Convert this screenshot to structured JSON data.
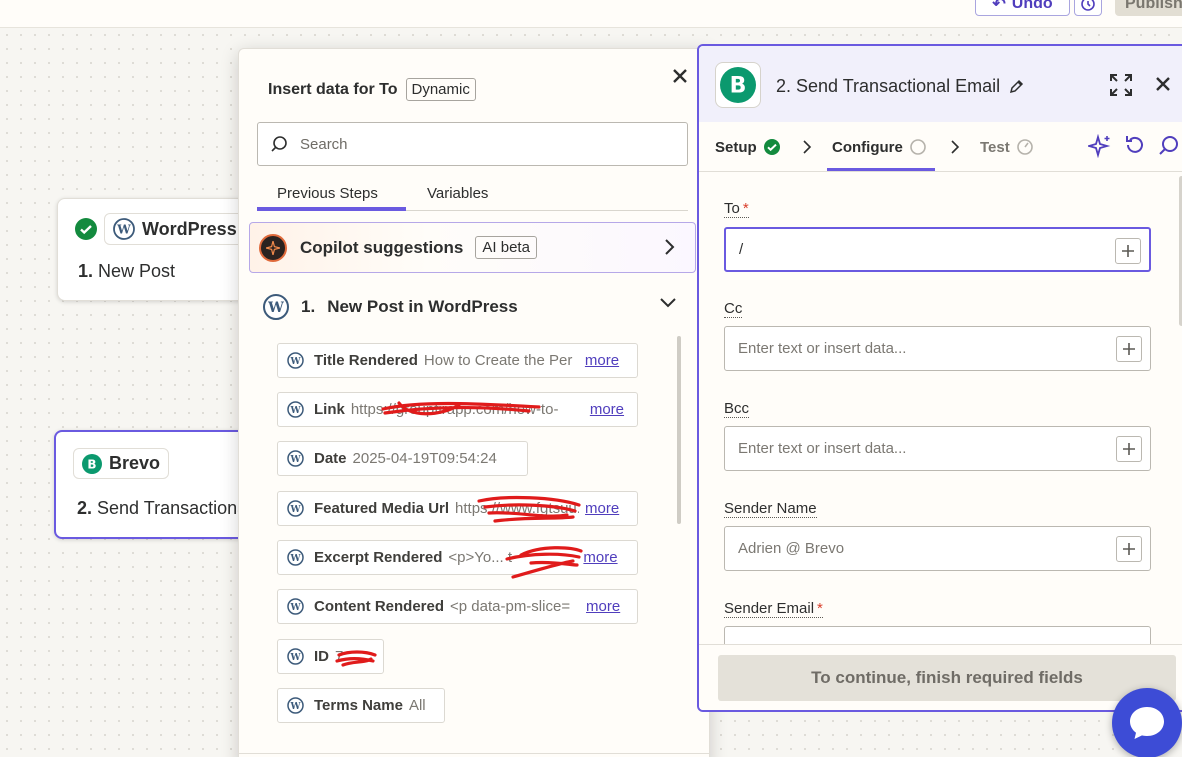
{
  "toolbar": {
    "undo_label": "Undo",
    "publish_label": "Publish"
  },
  "canvas": {
    "node1": {
      "app": "WordPress",
      "number": "1.",
      "title": "New Post"
    },
    "node2": {
      "app": "Brevo",
      "number": "2.",
      "title": "Send Transactional Email"
    }
  },
  "popover": {
    "title": "Insert data for To",
    "mode_tag": "Dynamic",
    "search_placeholder": "Search",
    "tabs": [
      "Previous Steps",
      "Variables"
    ],
    "copilot": {
      "label": "Copilot suggestions",
      "badge": "AI beta"
    },
    "step": {
      "number": "1.",
      "title": "New Post in WordPress"
    },
    "fields": [
      {
        "name": "Title Rendered",
        "value": "How to Create the Per",
        "more": "more"
      },
      {
        "name": "Link",
        "value": "https://groupfirapp.com/how-to-",
        "more": "more"
      },
      {
        "name": "Date",
        "value": "2025-04-19T09:54:24",
        "more": ""
      },
      {
        "name": "Featured Media Url",
        "value": "https://www.fgtsuu.up",
        "more": "more"
      },
      {
        "name": "Excerpt Rendered",
        "value": "<p>Yo... t",
        "more": "more"
      },
      {
        "name": "Content Rendered",
        "value": "<p data-pm-slice=",
        "more": "more"
      },
      {
        "name": "ID",
        "value": "7",
        "more": ""
      },
      {
        "name": "Terms Name",
        "value": "All",
        "more": ""
      }
    ]
  },
  "panel": {
    "title": "2. Send Transactional Email",
    "steps": {
      "setup": "Setup",
      "configure": "Configure",
      "test": "Test"
    },
    "fields": {
      "to": {
        "label": "To",
        "value": "/"
      },
      "cc": {
        "label": "Cc",
        "placeholder": "Enter text or insert data..."
      },
      "bcc": {
        "label": "Bcc",
        "placeholder": "Enter text or insert data..."
      },
      "sender_name": {
        "label": "Sender Name",
        "placeholder": "Adrien @ Brevo"
      },
      "sender_email": {
        "label": "Sender Email"
      }
    },
    "continue_label": "To continue, finish required fields"
  },
  "colors": {
    "accent": "#6a5ae0",
    "brevo_green": "#0b996e",
    "check_green": "#138a3e"
  }
}
